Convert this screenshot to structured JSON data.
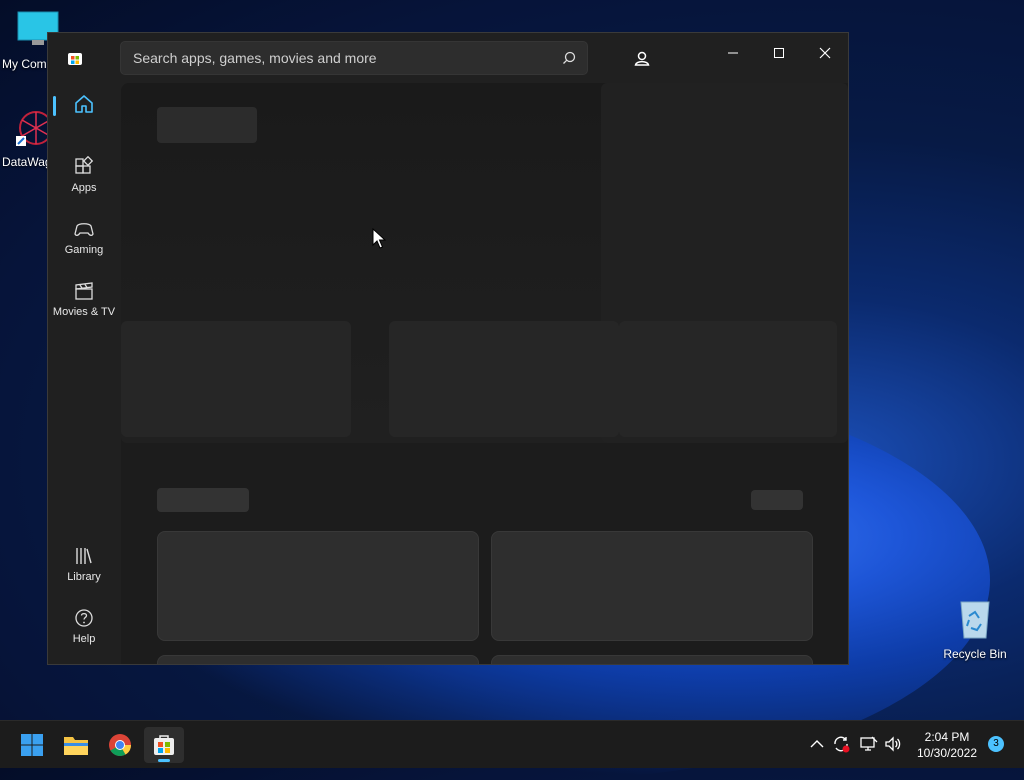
{
  "desktop": {
    "icons": [
      {
        "label": "My Com"
      },
      {
        "label": "DataWag"
      },
      {
        "label": "Recycle Bin"
      }
    ]
  },
  "window": {
    "search_placeholder": "Search apps, games, movies and more",
    "nav": {
      "home": "Home",
      "apps": "Apps",
      "gaming": "Gaming",
      "movies": "Movies & TV",
      "library": "Library",
      "help": "Help"
    }
  },
  "taskbar": {
    "time": "2:04 PM",
    "date": "10/30/2022",
    "notifications": "3"
  },
  "colors": {
    "accent": "#4cc2ff",
    "window_bg": "#202020",
    "skeleton": "#2e2e2e"
  }
}
